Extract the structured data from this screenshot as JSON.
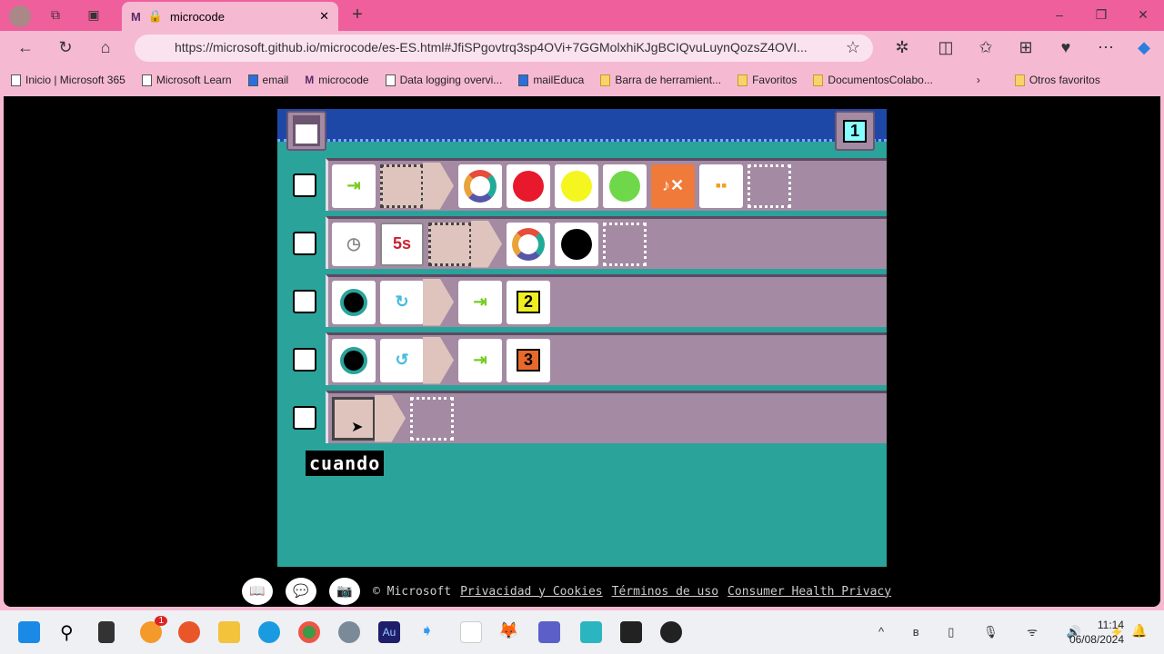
{
  "browser": {
    "tab_title": "microcode",
    "url": "https://microsoft.github.io/microcode/es-ES.html#JfiSPgovtrq3sp4OVi+7GGMolxhiKJgBCIQvuLuynQozsZ4OVI...",
    "bookmarks": [
      "Inicio | Microsoft 365",
      "Microsoft Learn",
      "email",
      "microcode",
      "Data logging overvi...",
      "mailEduca",
      "Barra de herramient...",
      "Favoritos",
      "DocumentosColabo..."
    ],
    "other_favorites": "Otros favoritos"
  },
  "app": {
    "page_number": "1",
    "tooltip": "cuando",
    "rows": [
      {
        "when": [
          "pin-input-icon",
          "empty"
        ],
        "do": [
          "color-ring-icon",
          "red",
          "yellow",
          "green",
          "sound-off-icon",
          "grid-icon",
          "empty"
        ]
      },
      {
        "when": [
          "timer-icon",
          "5s",
          "empty"
        ],
        "do": [
          "color-ring-icon",
          "black",
          "empty"
        ]
      },
      {
        "when": [
          "clock-icon",
          "rotate-icon"
        ],
        "do": [
          "switch-page-icon",
          "2"
        ]
      },
      {
        "when": [
          "clock-icon",
          "rotate-back-icon"
        ],
        "do": [
          "switch-page-icon",
          "3"
        ]
      },
      {
        "when": [
          "empty-selected"
        ],
        "do": [
          "empty"
        ]
      }
    ],
    "colors": {
      "red": "#e8192c",
      "yellow": "#f5f520",
      "green": "#6fd84a",
      "black": "#000000"
    }
  },
  "footer": {
    "copyright": "© Microsoft",
    "links": [
      "Privacidad y Cookies",
      "Términos de uso",
      "Consumer Health Privacy"
    ]
  },
  "taskbar": {
    "time": "11:14",
    "date": "06/08/2024",
    "badge": "1"
  }
}
